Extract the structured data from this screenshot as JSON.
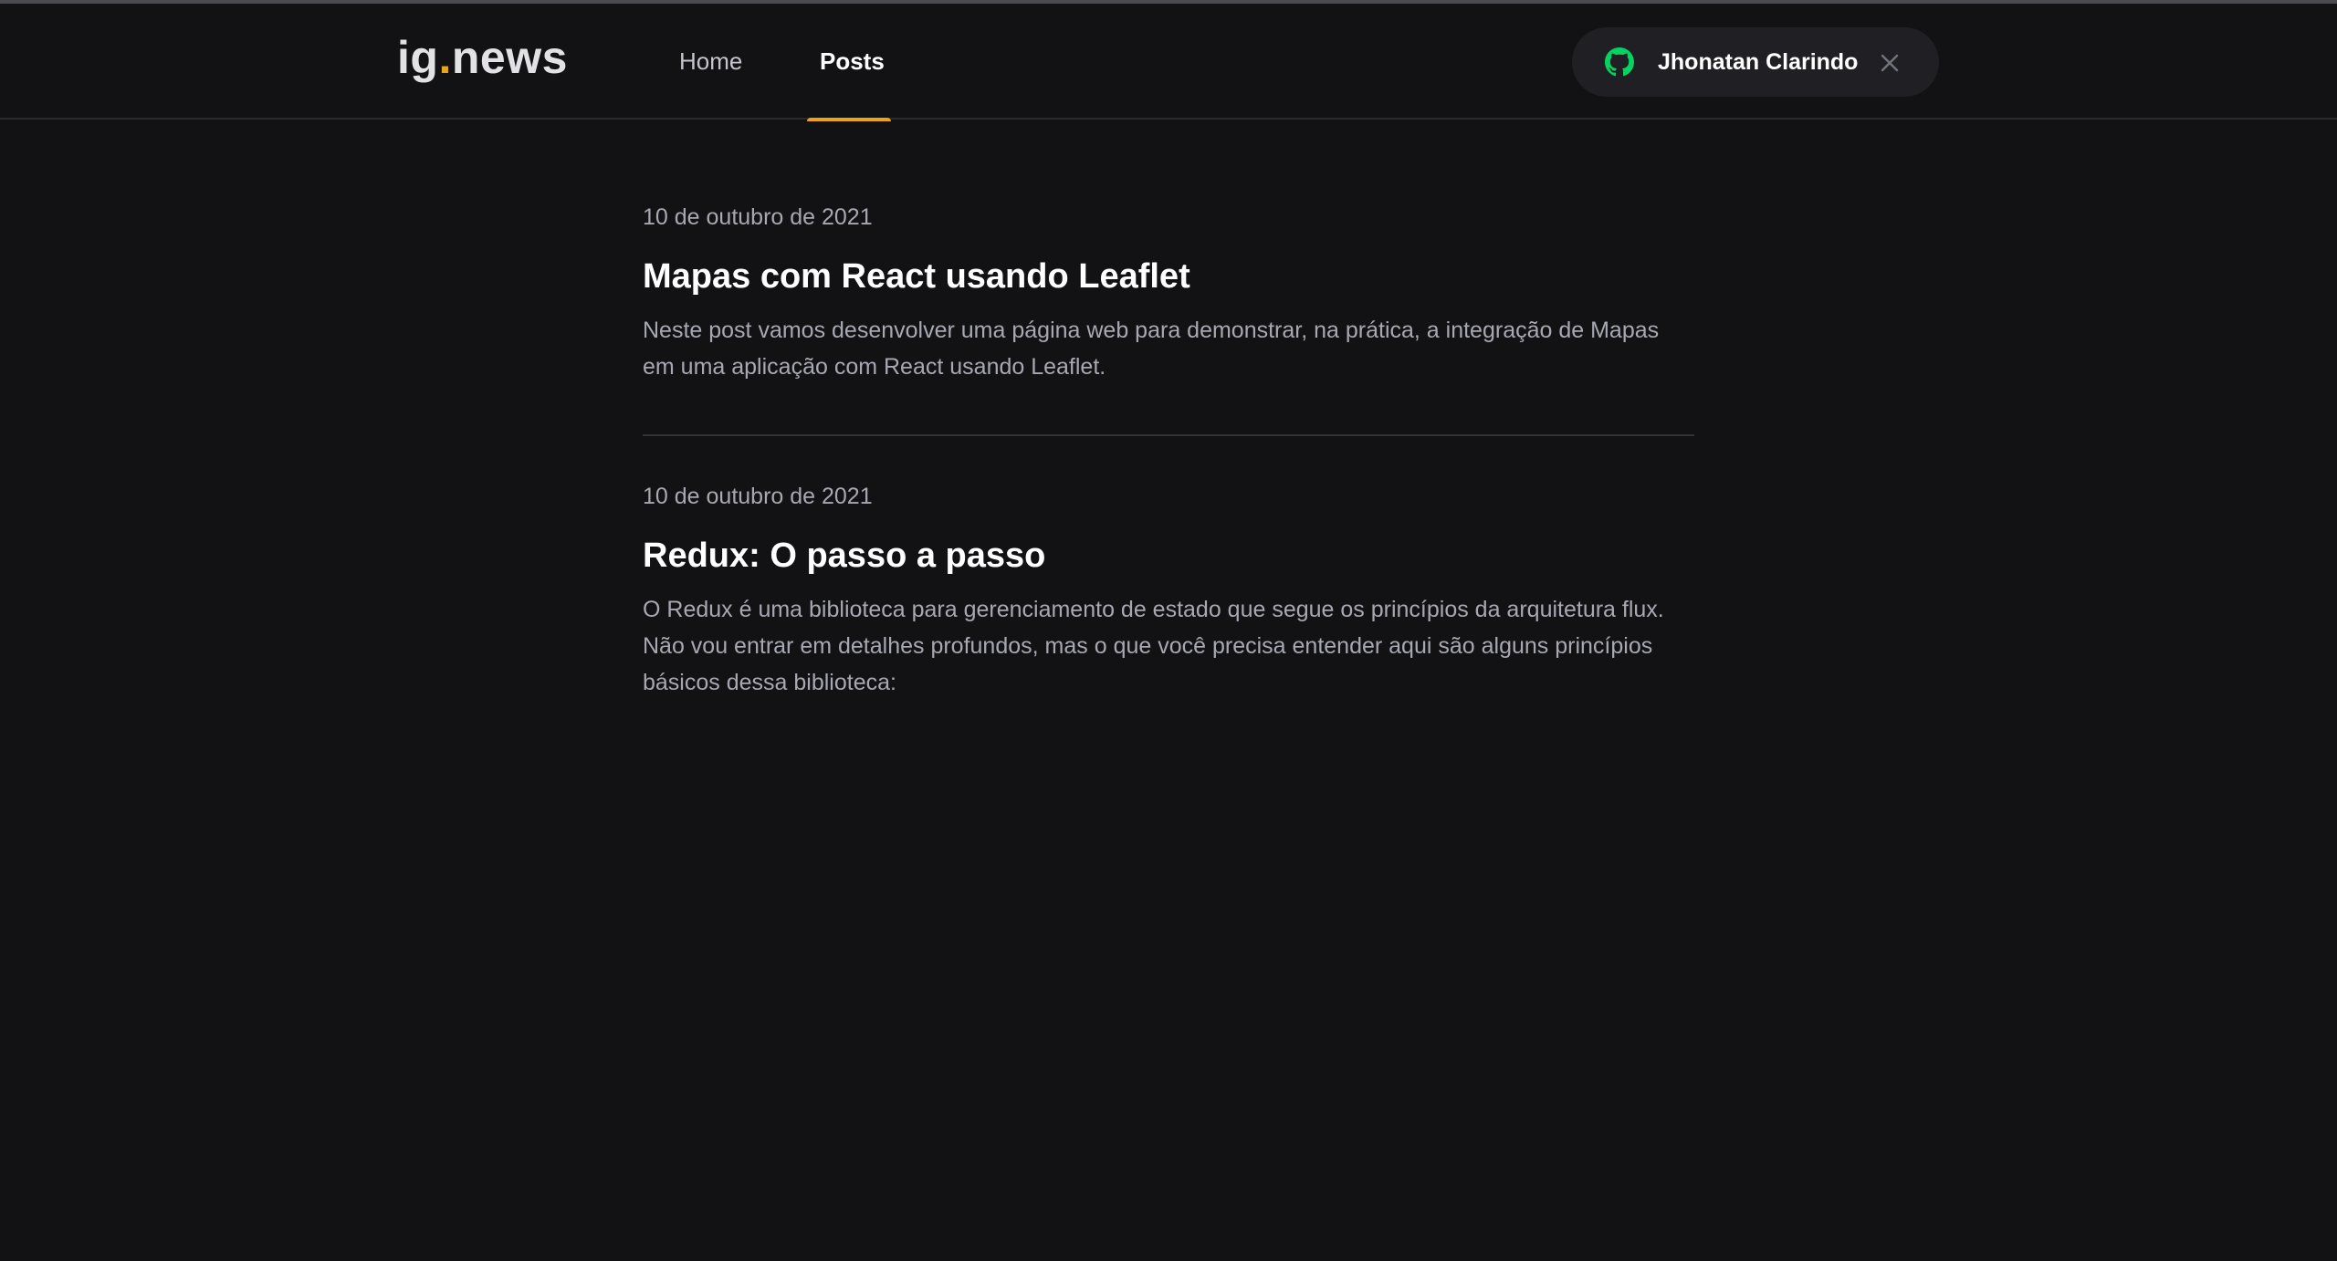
{
  "header": {
    "logo": {
      "main": "ig",
      "dot": ".",
      "rest": "news"
    },
    "nav": [
      {
        "label": "Home"
      },
      {
        "label": "Posts"
      }
    ],
    "user": {
      "name": "Jhonatan Clarindo",
      "icon": "github-icon",
      "close_icon": "close-icon"
    }
  },
  "colors": {
    "background": "#121214",
    "accent": "#eba417",
    "github_green": "#04d361",
    "text_muted": "#a8a8b3"
  },
  "posts": [
    {
      "date": "10 de outubro de 2021",
      "title": "Mapas com React usando Leaflet",
      "excerpt": "Neste post vamos desenvolver uma página web para demonstrar, na prática, a integração de Mapas em uma aplicação com React usando Leaflet."
    },
    {
      "date": "10 de outubro de 2021",
      "title": "Redux: O passo a passo",
      "excerpt": "O Redux é uma biblioteca para gerenciamento de estado que segue os princípios da arquitetura flux. Não vou entrar em detalhes profundos, mas o que você precisa entender aqui são alguns princípios básicos dessa biblioteca:"
    }
  ]
}
